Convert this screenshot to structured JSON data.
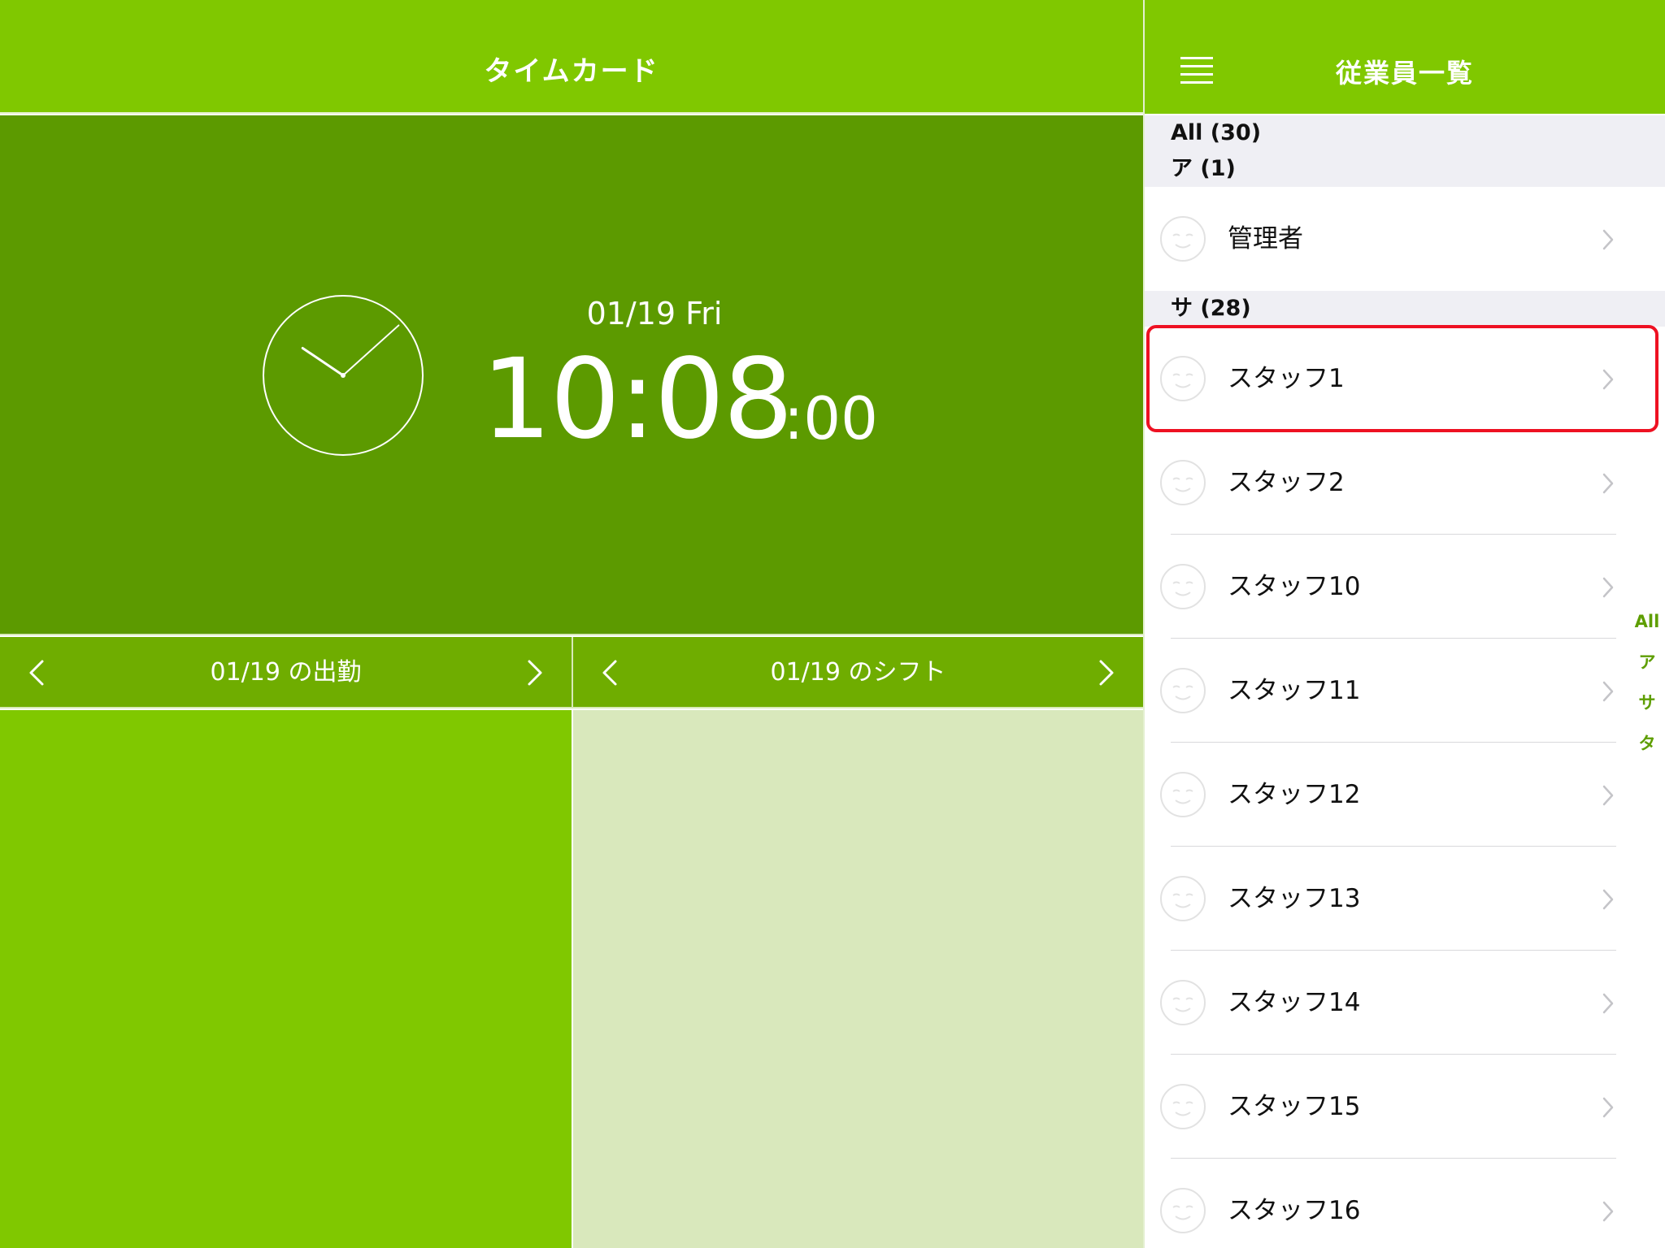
{
  "timecard": {
    "title": "タイムカード",
    "date": "01/19 Fri",
    "time": "10:08",
    "seconds": ":00",
    "clock_hands": {
      "hour": 10,
      "minute": 8
    },
    "attendance_nav": {
      "label": "01/19 の出勤"
    },
    "shift_nav": {
      "label": "01/19 のシフト"
    }
  },
  "employees": {
    "title": "従業員一覧",
    "all_label": "All (30)",
    "sections": [
      {
        "header": "ア (1)",
        "rows": [
          "管理者"
        ]
      },
      {
        "header": "サ (28)",
        "rows": [
          "スタッフ1",
          "スタッフ2",
          "スタッフ10",
          "スタッフ11",
          "スタッフ12",
          "スタッフ13",
          "スタッフ14",
          "スタッフ15",
          "スタッフ16"
        ]
      }
    ],
    "index": [
      "All",
      "ア",
      "サ",
      "タ"
    ],
    "selected": "スタッフ1"
  },
  "colors": {
    "brand": "#80c800",
    "clock_bg": "#5c9a00",
    "nav_bg": "#6fad00",
    "shift_bg": "#d9e8bc",
    "highlight": "#ee1122",
    "index_text": "#5e9e00"
  }
}
